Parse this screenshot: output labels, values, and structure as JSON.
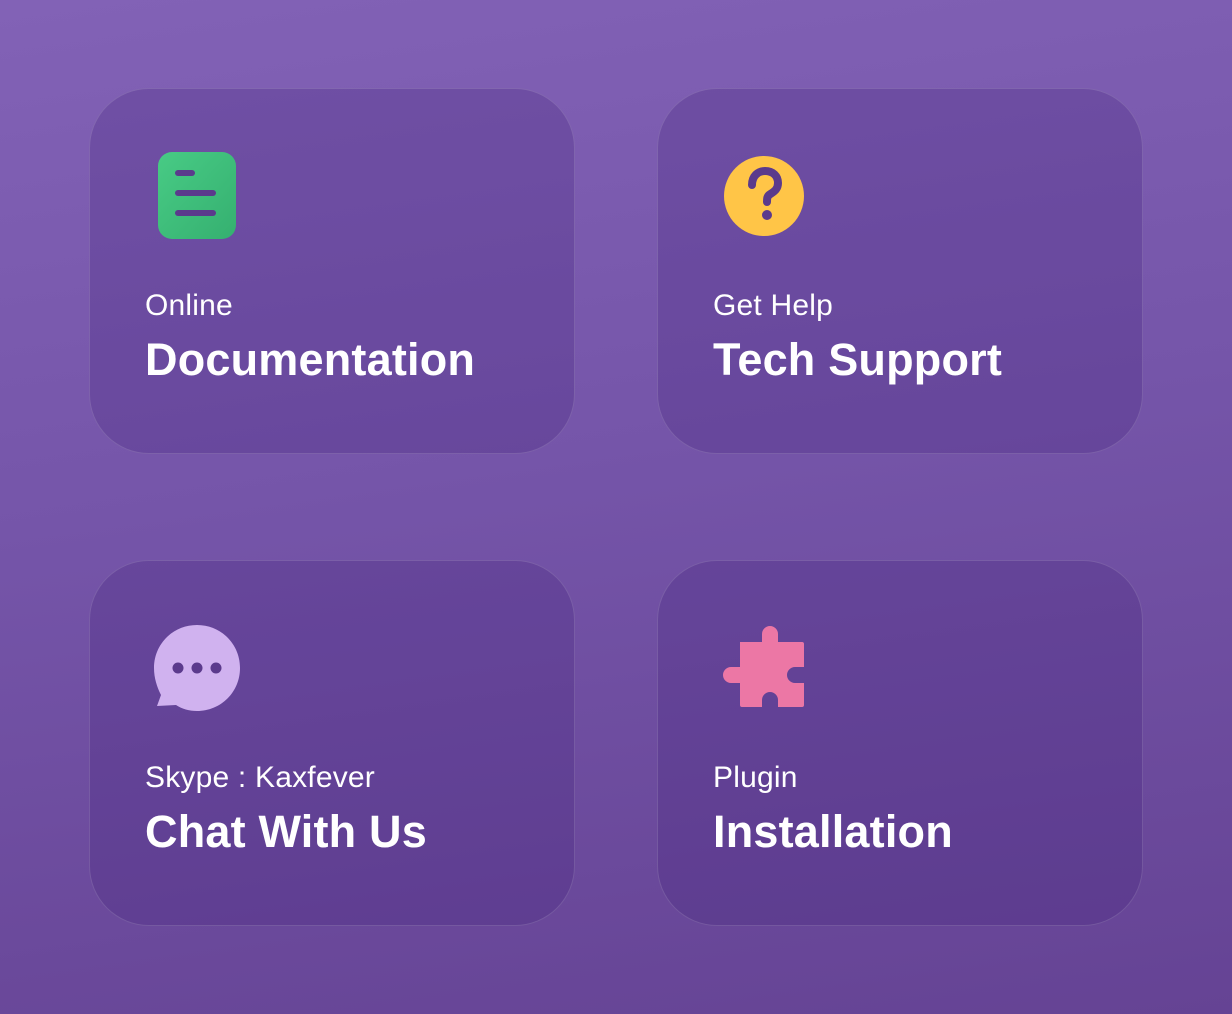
{
  "colors": {
    "background_top": "#8262b6",
    "background_bottom": "#654394",
    "text": "#ffffff",
    "docs_icon": "#3ec37c",
    "help_icon": "#ffc547",
    "chat_icon": "#d0b2ef",
    "plugin_icon": "#ec77a5"
  },
  "cards": [
    {
      "icon": "document-icon",
      "subtitle": "Online",
      "title": "Documentation"
    },
    {
      "icon": "question-mark-icon",
      "subtitle": "Get Help",
      "title": "Tech Support"
    },
    {
      "icon": "chat-bubble-icon",
      "subtitle": "Skype : Kaxfever",
      "title": "Chat With Us"
    },
    {
      "icon": "puzzle-piece-icon",
      "subtitle": "Plugin",
      "title": "Installation"
    }
  ]
}
